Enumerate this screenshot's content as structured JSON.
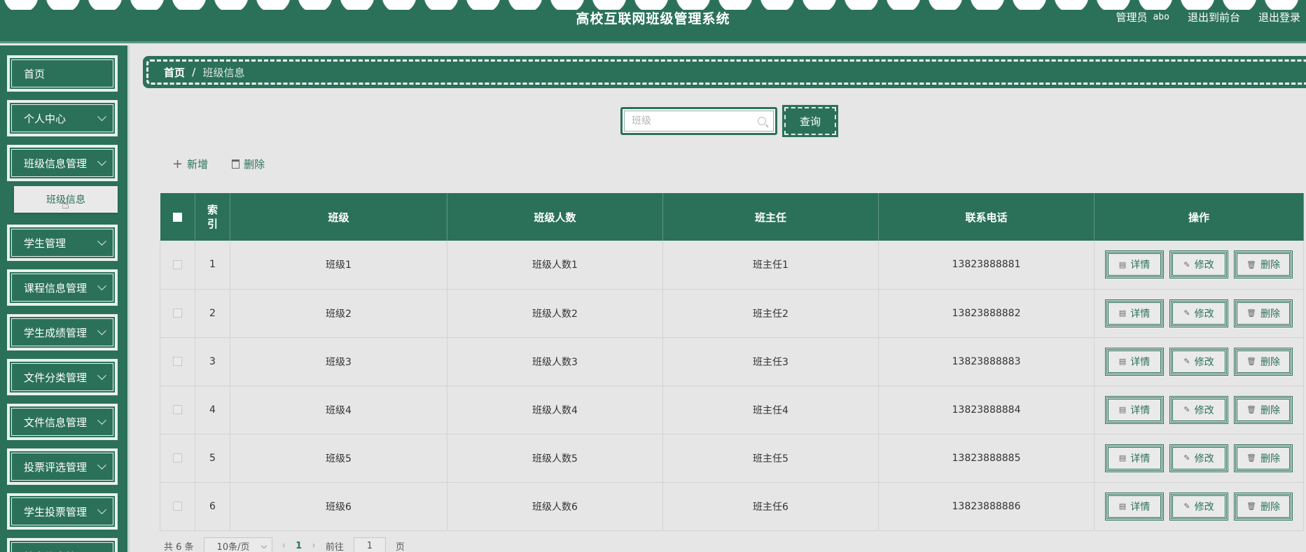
{
  "header": {
    "title": "高校互联网班级管理系统",
    "role": "管理员",
    "username": "abo",
    "exit_front": "退出到前台",
    "logout": "退出登录"
  },
  "sidebar": {
    "items": [
      {
        "label": "首页"
      },
      {
        "label": "个人中心"
      },
      {
        "label": "班级信息管理"
      },
      {
        "label": "学生管理"
      },
      {
        "label": "课程信息管理"
      },
      {
        "label": "学生成绩管理"
      },
      {
        "label": "文件分类管理"
      },
      {
        "label": "文件信息管理"
      },
      {
        "label": "投票评选管理"
      },
      {
        "label": "学生投票管理"
      },
      {
        "label": "档案信息管理"
      }
    ],
    "submenu": {
      "label": "班级信息"
    }
  },
  "breadcrumb": {
    "home": "首页",
    "sep": "/",
    "current": "班级信息"
  },
  "search": {
    "placeholder": "班级",
    "value": "",
    "button": "查询"
  },
  "actions": {
    "add": "新增",
    "delete": "删除"
  },
  "table": {
    "headers": {
      "index": "索\n引",
      "class": "班级",
      "count": "班级人数",
      "teacher": "班主任",
      "phone": "联系电话",
      "ops": "操作"
    },
    "op_labels": {
      "detail": "详情",
      "edit": "修改",
      "delete": "删除"
    },
    "rows": [
      {
        "index": "1",
        "class": "班级1",
        "count": "班级人数1",
        "teacher": "班主任1",
        "phone": "13823888881"
      },
      {
        "index": "2",
        "class": "班级2",
        "count": "班级人数2",
        "teacher": "班主任2",
        "phone": "13823888882"
      },
      {
        "index": "3",
        "class": "班级3",
        "count": "班级人数3",
        "teacher": "班主任3",
        "phone": "13823888883"
      },
      {
        "index": "4",
        "class": "班级4",
        "count": "班级人数4",
        "teacher": "班主任4",
        "phone": "13823888884"
      },
      {
        "index": "5",
        "class": "班级5",
        "count": "班级人数5",
        "teacher": "班主任5",
        "phone": "13823888885"
      },
      {
        "index": "6",
        "class": "班级6",
        "count": "班级人数6",
        "teacher": "班主任6",
        "phone": "13823888886"
      }
    ]
  },
  "pagination": {
    "total": "共 6 条",
    "page_size": "10条/页",
    "current_page": "1",
    "goto_label": "前往",
    "goto_value": "1",
    "page_suffix": "页"
  },
  "colors": {
    "primary": "#2b7159",
    "background": "#e6e6e6"
  }
}
